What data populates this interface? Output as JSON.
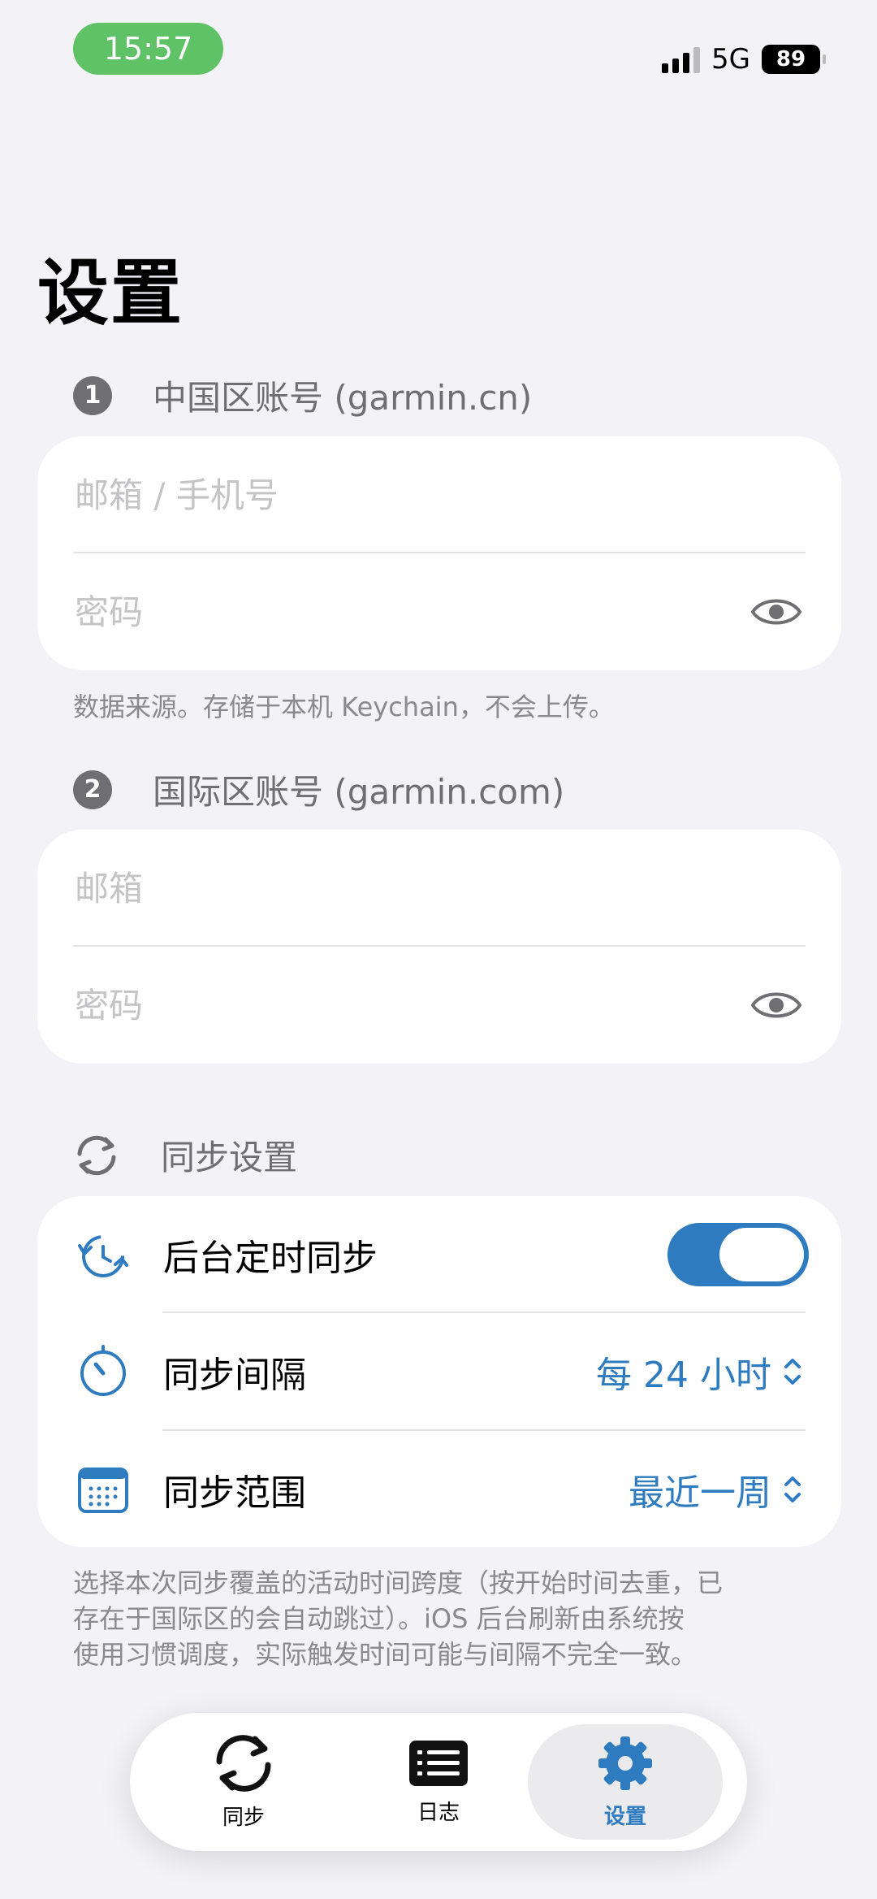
{
  "status_bar": {
    "time": "15:57",
    "network": "5G",
    "battery": "89"
  },
  "page": {
    "title": "设置"
  },
  "cn_account": {
    "badge": "1",
    "title": "中国区账号 (garmin.cn)",
    "email_placeholder": "邮箱 / 手机号",
    "password_placeholder": "密码",
    "note": "数据来源。存储于本机 Keychain，不会上传。"
  },
  "intl_account": {
    "badge": "2",
    "title": "国际区账号 (garmin.com)",
    "email_placeholder": "邮箱",
    "password_placeholder": "密码"
  },
  "sync_settings": {
    "title": "同步设置",
    "background_label": "后台定时同步",
    "background_enabled": true,
    "interval_label": "同步间隔",
    "interval_value": "每 24 小时",
    "range_label": "同步范围",
    "range_value": "最近一周",
    "note_line1": "选择本次同步覆盖的活动时间跨度（按开始时间去重，已",
    "note_line2": "存在于国际区的会自动跳过）。iOS 后台刷新由系统按",
    "note_line3": "使用习惯调度，实际触发时间可能与间隔不完全一致。"
  },
  "tabs": [
    {
      "label": "同步",
      "icon": "sync-icon"
    },
    {
      "label": "日志",
      "icon": "list-icon"
    },
    {
      "label": "设置",
      "icon": "gear-icon",
      "active": true
    }
  ],
  "colors": {
    "accent": "#2f7bbf",
    "background": "#f2f2f7",
    "time_pill": "#5fc267"
  }
}
